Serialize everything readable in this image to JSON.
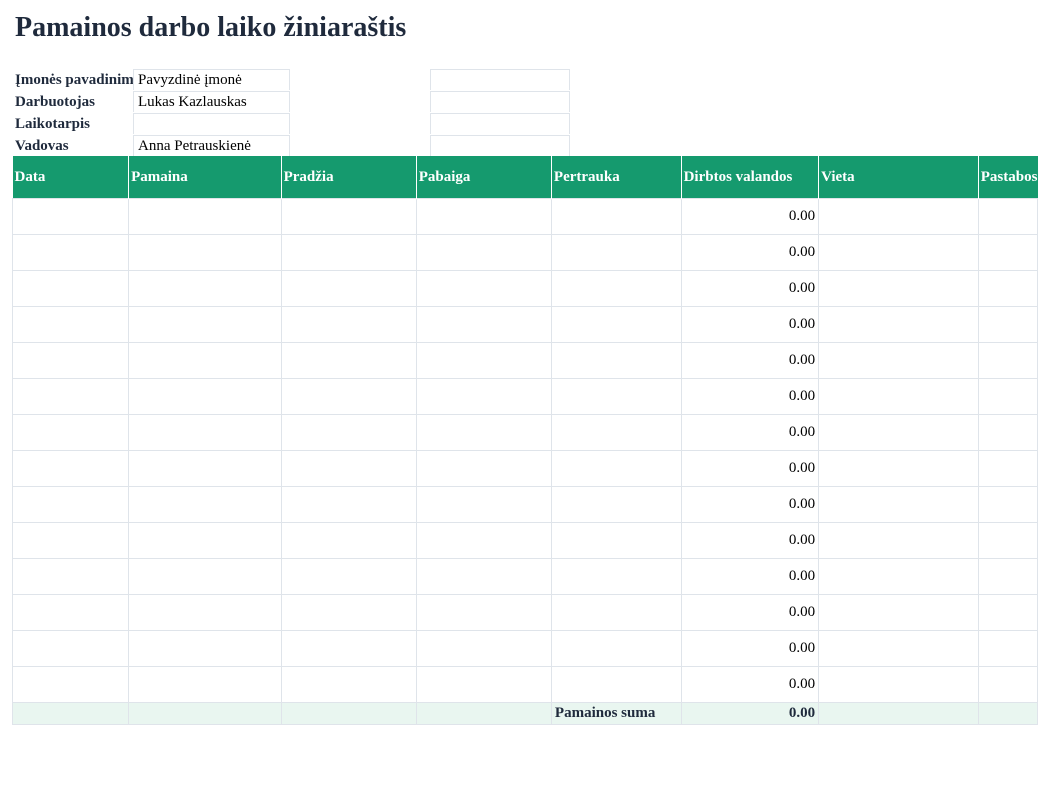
{
  "sheet": {
    "title": "Pamainos darbo laiko žiniaraštis"
  },
  "info": {
    "rows": [
      {
        "label": "Įmonės pavadinimas",
        "value": "Pavyzdinė įmonė"
      },
      {
        "label": "Darbuotojas",
        "value": "Lukas Kazlauskas"
      },
      {
        "label": "Laikotarpis",
        "value": ""
      },
      {
        "label": "Vadovas",
        "value": "Anna Petrauskienė"
      }
    ]
  },
  "table": {
    "headers": [
      "Data",
      "Pamaina",
      "Pradžia",
      "Pabaiga",
      "Pertrauka",
      "Dirbtos valandos",
      "Vieta",
      "Pastabos"
    ],
    "hours": [
      "0.00",
      "0.00",
      "0.00",
      "0.00",
      "0.00",
      "0.00",
      "0.00",
      "0.00",
      "0.00",
      "0.00",
      "0.00",
      "0.00",
      "0.00",
      "0.00"
    ],
    "total_label": "Pamainos suma",
    "total_value": "0.00"
  },
  "colors": {
    "header_bg": "#159a6e",
    "total_bg": "#e9f6f0",
    "title": "#1f2a3c"
  }
}
